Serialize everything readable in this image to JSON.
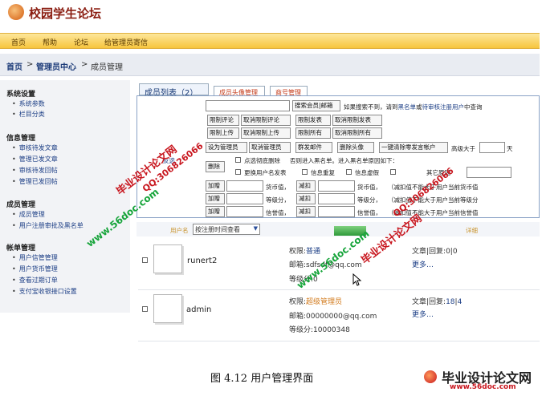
{
  "app": {
    "title": "校园学生论坛"
  },
  "nav": [
    "首页",
    "帮助",
    "论坛",
    "给管理员寄信"
  ],
  "breadcrumb": {
    "home": "首页",
    "sep": ">",
    "center": "管理员中心",
    "page": "成员管理"
  },
  "sidebar": [
    {
      "heading": "系统设置",
      "items": [
        "系统参数",
        "栏目分类"
      ]
    },
    {
      "heading": "信息管理",
      "items": [
        "审核待发文章",
        "管理已发文章",
        "审核待发回帖",
        "管理已发回帖"
      ]
    },
    {
      "heading": "成员管理",
      "items": [
        "成员管理",
        "用户注册审批及黑名单"
      ]
    },
    {
      "heading": "帐单管理",
      "items": [
        "用户信管管理",
        "用户货币管理",
        "查看过期订单",
        "支付宝收银接口设置"
      ]
    }
  ],
  "tabs": {
    "members": "成员列表（2）",
    "avatar": "成员头像管理",
    "vip": "商号管理"
  },
  "toolbar": {
    "search_btn": "搜索会员|邮箱",
    "search_hint": "如果搜索不到，请到",
    "search_hint_link": "黑名单",
    "search_hint_or": "或",
    "search_hint_link2": "待审核注册用户",
    "search_hint_tail": "中查询",
    "limit_comment": "限制评论",
    "unlimit_comment": "取消限制评论",
    "limit_post": "限制发表",
    "unlimit_post": "取消限制发表",
    "limit_upload": "限制上传",
    "unlimit_upload": "取消限制上传",
    "limit_all": "限制所有",
    "unlimit_all": "取消限制所有",
    "set_admin": "设为管理员",
    "unset_admin": "取消管理员",
    "send_mail": "群发邮件",
    "del_avatar": "删除头像",
    "clear_posts": "一键清除零发言帐户",
    "level_above": "高级大于",
    "day": "天",
    "select_all": "反选",
    "delete": "删除",
    "ban_delete": "点选彻底删除",
    "ban_reason": "否则进入黑名单。进入黑名单原因如下：",
    "ban_user": "更换用户名发表",
    "info_repeat": "信息重复",
    "info_fake": "信息虚假",
    "other_reason": "其它原因",
    "add": "加赠",
    "deduct": "减扣",
    "currency": "货币值，",
    "level": "等级分，",
    "credit": "信誉值，",
    "note_currency": "（减扣值不能大于用户当前货币值",
    "note_level": "（减扣值不能大于用户当前等级分",
    "note_credit": "（减扣值不能大于用户当前信誉值"
  },
  "list": {
    "col_user": "用户名",
    "sort_select": "按注册时间查看",
    "col_detail": "详细"
  },
  "users": [
    {
      "name": "runert2",
      "perm_label": "权限:",
      "perm": "普通",
      "email": "邮箱:sdfsdf@qq.com",
      "level": "等级分:0",
      "stats": "文章|回复:0|0",
      "more": "更多…"
    },
    {
      "name": "admin",
      "perm_label": "权限:",
      "perm": "超级管理员",
      "email": "邮箱:00000000@qq.com",
      "level": "等级分:10000348",
      "stats_label": "文章|回复:",
      "stats_a": "18",
      "stats_sep": "|",
      "stats_b": "4",
      "more": "更多…"
    }
  ],
  "watermarks": [
    "毕业设计论文网",
    "QQ:306826066",
    "www.56doc.com"
  ],
  "caption": "图 4.12 用户管理界面",
  "footer": {
    "logo": "毕业设计论文网",
    "url": "www.56doc.com"
  }
}
